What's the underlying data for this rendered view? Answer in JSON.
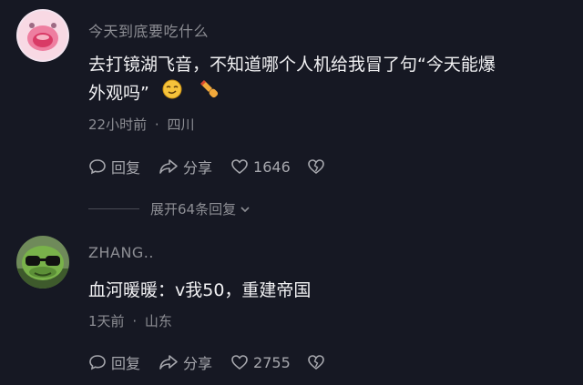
{
  "comments": [
    {
      "username": "今天到底要吃什么",
      "text_line1": "去打镜湖飞音，不知道哪个人机给我冒了句“今天能爆",
      "text_line2": "外观吗”",
      "emojis": [
        "smirk-face-icon",
        "pointing-hand-icon"
      ],
      "time": "22小时前",
      "location": "四川",
      "reply_label": "回复",
      "share_label": "分享",
      "like_count": "1646"
    },
    {
      "username": "ZHANG..",
      "text": "血河暖暖：v我50，重建帝国",
      "time": "1天前",
      "location": "山东",
      "reply_label": "回复",
      "share_label": "分享",
      "like_count": "2755"
    }
  ],
  "expand_replies": "展开64条回复",
  "meta_separator": "·",
  "colors": {
    "background": "#161823",
    "text": "#f1f1f3",
    "muted": "#8d8e94"
  }
}
